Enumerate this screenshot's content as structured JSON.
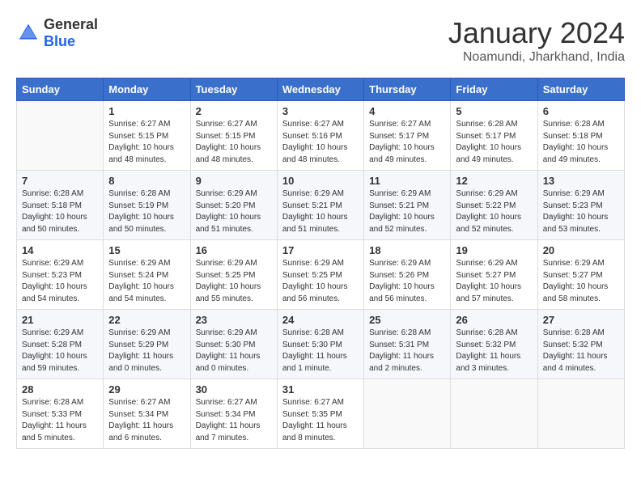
{
  "logo": {
    "general": "General",
    "blue": "Blue"
  },
  "title": "January 2024",
  "subtitle": "Noamundi, Jharkhand, India",
  "weekdays": [
    "Sunday",
    "Monday",
    "Tuesday",
    "Wednesday",
    "Thursday",
    "Friday",
    "Saturday"
  ],
  "weeks": [
    [
      {
        "num": "",
        "info": ""
      },
      {
        "num": "1",
        "info": "Sunrise: 6:27 AM\nSunset: 5:15 PM\nDaylight: 10 hours\nand 48 minutes."
      },
      {
        "num": "2",
        "info": "Sunrise: 6:27 AM\nSunset: 5:15 PM\nDaylight: 10 hours\nand 48 minutes."
      },
      {
        "num": "3",
        "info": "Sunrise: 6:27 AM\nSunset: 5:16 PM\nDaylight: 10 hours\nand 48 minutes."
      },
      {
        "num": "4",
        "info": "Sunrise: 6:27 AM\nSunset: 5:17 PM\nDaylight: 10 hours\nand 49 minutes."
      },
      {
        "num": "5",
        "info": "Sunrise: 6:28 AM\nSunset: 5:17 PM\nDaylight: 10 hours\nand 49 minutes."
      },
      {
        "num": "6",
        "info": "Sunrise: 6:28 AM\nSunset: 5:18 PM\nDaylight: 10 hours\nand 49 minutes."
      }
    ],
    [
      {
        "num": "7",
        "info": "Sunrise: 6:28 AM\nSunset: 5:18 PM\nDaylight: 10 hours\nand 50 minutes."
      },
      {
        "num": "8",
        "info": "Sunrise: 6:28 AM\nSunset: 5:19 PM\nDaylight: 10 hours\nand 50 minutes."
      },
      {
        "num": "9",
        "info": "Sunrise: 6:29 AM\nSunset: 5:20 PM\nDaylight: 10 hours\nand 51 minutes."
      },
      {
        "num": "10",
        "info": "Sunrise: 6:29 AM\nSunset: 5:21 PM\nDaylight: 10 hours\nand 51 minutes."
      },
      {
        "num": "11",
        "info": "Sunrise: 6:29 AM\nSunset: 5:21 PM\nDaylight: 10 hours\nand 52 minutes."
      },
      {
        "num": "12",
        "info": "Sunrise: 6:29 AM\nSunset: 5:22 PM\nDaylight: 10 hours\nand 52 minutes."
      },
      {
        "num": "13",
        "info": "Sunrise: 6:29 AM\nSunset: 5:23 PM\nDaylight: 10 hours\nand 53 minutes."
      }
    ],
    [
      {
        "num": "14",
        "info": "Sunrise: 6:29 AM\nSunset: 5:23 PM\nDaylight: 10 hours\nand 54 minutes."
      },
      {
        "num": "15",
        "info": "Sunrise: 6:29 AM\nSunset: 5:24 PM\nDaylight: 10 hours\nand 54 minutes."
      },
      {
        "num": "16",
        "info": "Sunrise: 6:29 AM\nSunset: 5:25 PM\nDaylight: 10 hours\nand 55 minutes."
      },
      {
        "num": "17",
        "info": "Sunrise: 6:29 AM\nSunset: 5:25 PM\nDaylight: 10 hours\nand 56 minutes."
      },
      {
        "num": "18",
        "info": "Sunrise: 6:29 AM\nSunset: 5:26 PM\nDaylight: 10 hours\nand 56 minutes."
      },
      {
        "num": "19",
        "info": "Sunrise: 6:29 AM\nSunset: 5:27 PM\nDaylight: 10 hours\nand 57 minutes."
      },
      {
        "num": "20",
        "info": "Sunrise: 6:29 AM\nSunset: 5:27 PM\nDaylight: 10 hours\nand 58 minutes."
      }
    ],
    [
      {
        "num": "21",
        "info": "Sunrise: 6:29 AM\nSunset: 5:28 PM\nDaylight: 10 hours\nand 59 minutes."
      },
      {
        "num": "22",
        "info": "Sunrise: 6:29 AM\nSunset: 5:29 PM\nDaylight: 11 hours\nand 0 minutes."
      },
      {
        "num": "23",
        "info": "Sunrise: 6:29 AM\nSunset: 5:30 PM\nDaylight: 11 hours\nand 0 minutes."
      },
      {
        "num": "24",
        "info": "Sunrise: 6:28 AM\nSunset: 5:30 PM\nDaylight: 11 hours\nand 1 minute."
      },
      {
        "num": "25",
        "info": "Sunrise: 6:28 AM\nSunset: 5:31 PM\nDaylight: 11 hours\nand 2 minutes."
      },
      {
        "num": "26",
        "info": "Sunrise: 6:28 AM\nSunset: 5:32 PM\nDaylight: 11 hours\nand 3 minutes."
      },
      {
        "num": "27",
        "info": "Sunrise: 6:28 AM\nSunset: 5:32 PM\nDaylight: 11 hours\nand 4 minutes."
      }
    ],
    [
      {
        "num": "28",
        "info": "Sunrise: 6:28 AM\nSunset: 5:33 PM\nDaylight: 11 hours\nand 5 minutes."
      },
      {
        "num": "29",
        "info": "Sunrise: 6:27 AM\nSunset: 5:34 PM\nDaylight: 11 hours\nand 6 minutes."
      },
      {
        "num": "30",
        "info": "Sunrise: 6:27 AM\nSunset: 5:34 PM\nDaylight: 11 hours\nand 7 minutes."
      },
      {
        "num": "31",
        "info": "Sunrise: 6:27 AM\nSunset: 5:35 PM\nDaylight: 11 hours\nand 8 minutes."
      },
      {
        "num": "",
        "info": ""
      },
      {
        "num": "",
        "info": ""
      },
      {
        "num": "",
        "info": ""
      }
    ]
  ]
}
